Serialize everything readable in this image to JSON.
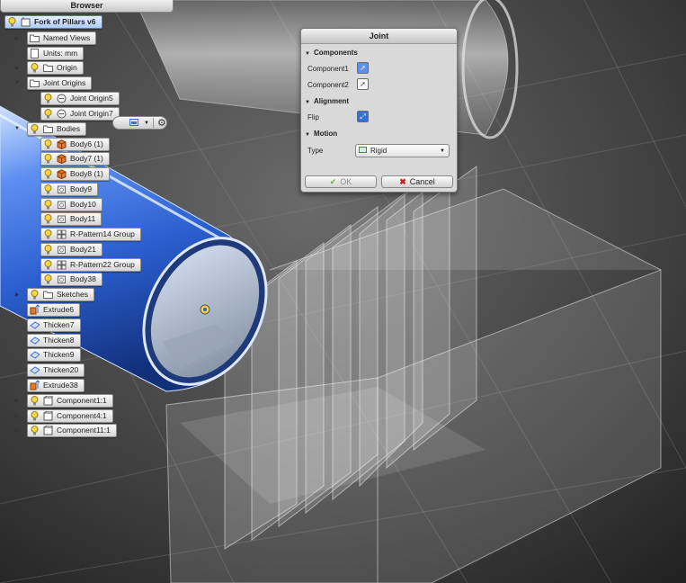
{
  "browser": {
    "title": "Browser",
    "root": "Fork of Pillars v6",
    "items": [
      {
        "label": "Named Views"
      },
      {
        "label": "Units: mm"
      },
      {
        "label": "Origin"
      },
      {
        "label": "Joint Origins"
      },
      {
        "label": "Joint Origin5"
      },
      {
        "label": "Joint Origin7"
      },
      {
        "label": "Bodies"
      },
      {
        "label": "Body6 (1)"
      },
      {
        "label": "Body7 (1)"
      },
      {
        "label": "Body8 (1)"
      },
      {
        "label": "Body9"
      },
      {
        "label": "Body10"
      },
      {
        "label": "Body11"
      },
      {
        "label": "R-Pattern14 Group"
      },
      {
        "label": "Body21"
      },
      {
        "label": "R-Pattern22 Group"
      },
      {
        "label": "Body38"
      },
      {
        "label": "Sketches"
      },
      {
        "label": "Extrude6"
      },
      {
        "label": "Thicken7"
      },
      {
        "label": "Thicken8"
      },
      {
        "label": "Thicken9"
      },
      {
        "label": "Thicken20"
      },
      {
        "label": "Extrude38"
      },
      {
        "label": "Component1:1"
      },
      {
        "label": "Component4:1"
      },
      {
        "label": "Component11:1"
      }
    ]
  },
  "joint": {
    "title": "Joint",
    "sections": {
      "components": "Components",
      "alignment": "Alignment",
      "motion": "Motion"
    },
    "component1_label": "Component1",
    "component2_label": "Component2",
    "flip_label": "Flip",
    "type_label": "Type",
    "type_value": "Rigid",
    "ok_label": "OK",
    "cancel_label": "Cancel"
  },
  "colors": {
    "accent_blue": "#3a6fd6",
    "selection_pill": "#aecbf2",
    "cancel_x": "#c02020",
    "ok_check": "#6ab04c",
    "body_orange": "#e07a2e"
  }
}
